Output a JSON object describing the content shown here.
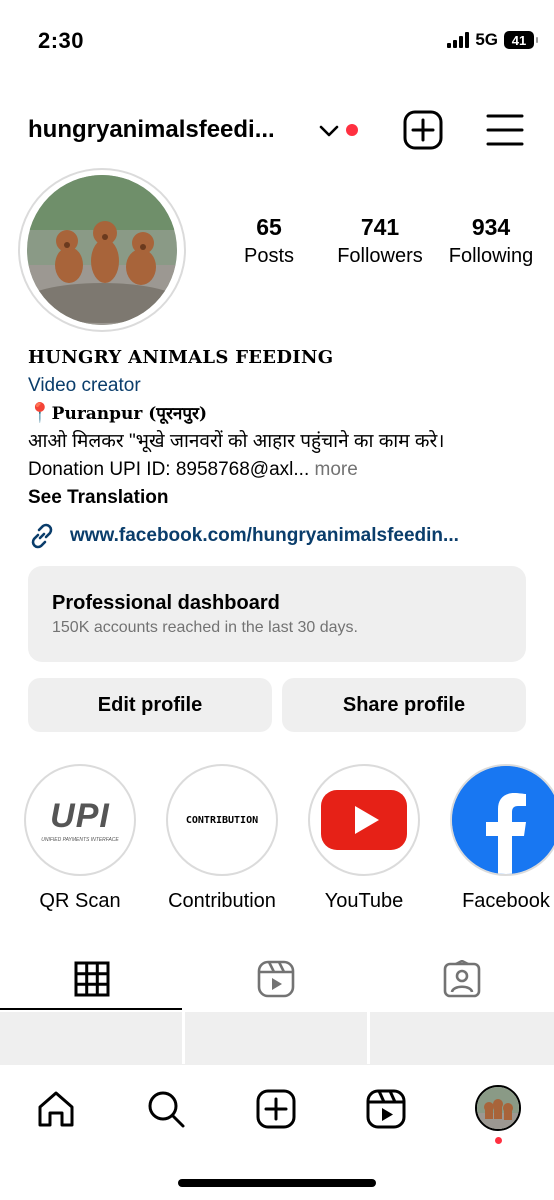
{
  "status_bar": {
    "time": "2:30",
    "network": "5G",
    "battery": "41"
  },
  "header": {
    "username": "hungryanimalsfeedi...",
    "icons": [
      "chevron-down-icon",
      "plus-square-icon",
      "hamburger-menu-icon"
    ]
  },
  "stats": {
    "posts": {
      "value": "65",
      "label": "Posts"
    },
    "followers": {
      "value": "741",
      "label": "Followers"
    },
    "following": {
      "value": "934",
      "label": "Following"
    }
  },
  "bio": {
    "name": "HUNGRY ANIMALS FEEDING",
    "category": "Video creator",
    "location": "Puranpur (पूरनपुर)",
    "line1": "आओ मिलकर \"भूखे जानवरों को आहार पहुंचाने का काम करे।",
    "line2": "Donation UPI ID: 8958768@axl...",
    "more": " more",
    "see_translation": "See Translation",
    "link": "www.facebook.com/hungryanimalsfeedin..."
  },
  "dashboard": {
    "title": "Professional dashboard",
    "subtitle": "150K accounts reached in the last 30 days."
  },
  "buttons": {
    "edit": "Edit profile",
    "share": "Share profile"
  },
  "highlights": [
    {
      "label": "QR Scan",
      "cover_text": "UPI",
      "cover_sub": "UNIFIED PAYMENTS INTERFACE"
    },
    {
      "label": "Contribution",
      "cover_text": "CONTRIBUTION"
    },
    {
      "label": "YouTube"
    },
    {
      "label": "Facebook"
    }
  ],
  "colors": {
    "link": "#0a3d6b",
    "notification": "#ff3040",
    "youtube": "#e62117",
    "facebook": "#1877f2",
    "secondary_text": "#737373",
    "button_bg": "#efefef"
  },
  "tabs": [
    "grid-icon",
    "reels-icon",
    "tagged-icon"
  ],
  "bottom_nav": [
    "home-icon",
    "search-icon",
    "create-icon",
    "reels-icon",
    "profile-avatar"
  ]
}
